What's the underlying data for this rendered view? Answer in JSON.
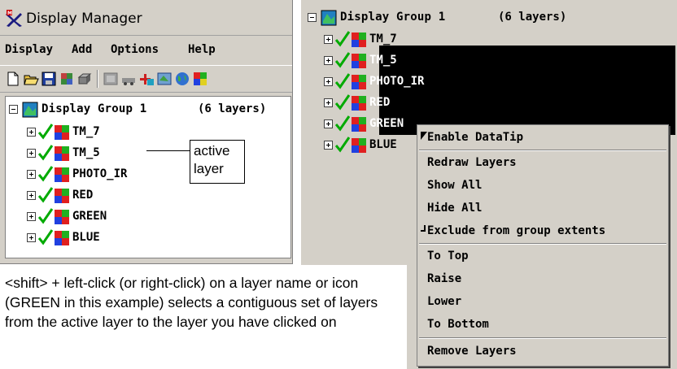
{
  "left_window": {
    "title": "Display Manager",
    "menu": [
      "Display",
      "Add",
      "Options",
      "Help"
    ],
    "tree": {
      "group_label": "Display Group 1",
      "group_count": "(6 layers)",
      "layers": [
        "TM_7",
        "TM_5",
        "PHOTO_IR",
        "RED",
        "GREEN",
        "BLUE"
      ]
    },
    "callout": "active layer"
  },
  "right_window": {
    "tree": {
      "group_label": "Display Group 1",
      "group_count": "(6 layers)",
      "layers": [
        "TM_7",
        "TM_5",
        "PHOTO_IR",
        "RED",
        "GREEN",
        "BLUE"
      ]
    },
    "context_menu": {
      "items": [
        {
          "label": "Enable DataTip",
          "mark": "checked"
        },
        {
          "label": "Redraw Layers"
        },
        {
          "label": "Show All"
        },
        {
          "label": "Hide All"
        },
        {
          "label": "Exclude from group extents",
          "mark": "toggle-off"
        },
        {
          "label": "To Top"
        },
        {
          "label": "Raise"
        },
        {
          "label": "Lower"
        },
        {
          "label": "To Bottom"
        },
        {
          "label": "Remove Layers"
        }
      ]
    }
  },
  "explanation": "<shift> + left-click (or right-click) on a layer name or icon (GREEN in this example) selects a contiguous set of layers from the active layer to the layer you have clicked on",
  "colors": {
    "window_bg": "#d4d0c8",
    "selection_bg": "#000000",
    "check_green": "#00aa00"
  },
  "icons": {
    "app": "display-manager-icon",
    "layer": "raster-layer-icon",
    "group": "display-group-icon",
    "check": "checkmark-icon"
  }
}
